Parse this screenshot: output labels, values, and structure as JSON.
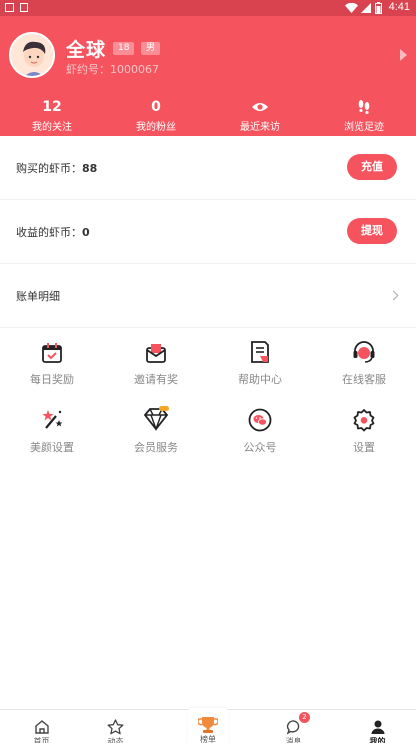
{
  "status_bar": {
    "time": "4:41"
  },
  "profile": {
    "nickname": "全球",
    "age_badge": "18",
    "gender_badge": "男",
    "user_id": "虾约号：1000067"
  },
  "stats": [
    {
      "value": "12",
      "label": "我的关注"
    },
    {
      "value": "0",
      "label": "我的粉丝"
    },
    {
      "icon": "eye-icon",
      "label": "最近来访"
    },
    {
      "icon": "footprints-icon",
      "label": "浏览足迹"
    }
  ],
  "wallet": {
    "bought_label": "购买的虾币：",
    "bought_value": "88",
    "recharge_button": "充值",
    "earned_label": "收益的虾币：",
    "earned_value": "0",
    "withdraw_button": "提现",
    "bill_label": "账单明细"
  },
  "grid": [
    {
      "icon": "calendar-check-icon",
      "label": "每日奖励"
    },
    {
      "icon": "invite-envelope-icon",
      "label": "邀请有奖"
    },
    {
      "icon": "help-document-icon",
      "label": "帮助中心"
    },
    {
      "icon": "customer-service-icon",
      "label": "在线客服"
    },
    {
      "icon": "magic-wand-icon",
      "label": "美颜设置"
    },
    {
      "icon": "diamond-vip-icon",
      "label": "会员服务"
    },
    {
      "icon": "wechat-icon",
      "label": "公众号"
    },
    {
      "icon": "settings-gear-icon",
      "label": "设置"
    }
  ],
  "tabbar": {
    "items": [
      {
        "icon": "home-icon",
        "label": "首页"
      },
      {
        "icon": "star-icon",
        "label": "动态"
      },
      {
        "icon": "trophy-icon",
        "label": "榜单"
      },
      {
        "icon": "message-icon",
        "label": "消息",
        "badge": "2"
      },
      {
        "icon": "person-icon",
        "label": "我的"
      }
    ]
  },
  "colors": {
    "primary": "#f5545f",
    "status_bar": "#d9424f"
  }
}
